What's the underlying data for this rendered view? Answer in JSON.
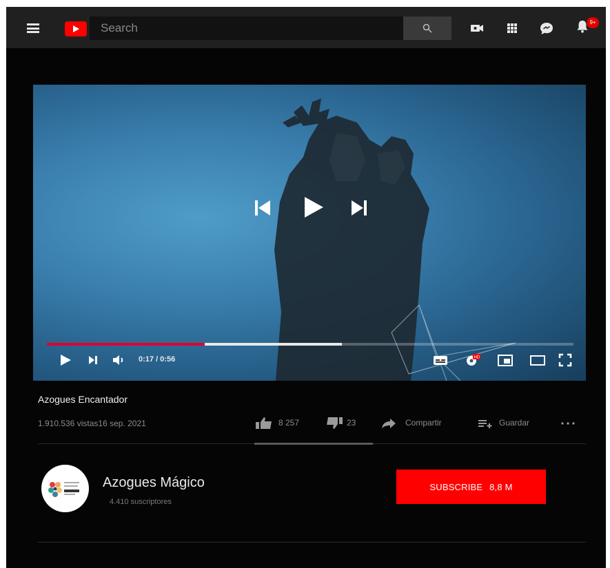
{
  "header": {
    "search_placeholder": "Search",
    "notification_count": "9+"
  },
  "player": {
    "current_time": "0:17",
    "duration": "0:56",
    "time_display": "0:17 / 0:56",
    "played_fraction": 0.3,
    "buffered_fraction": 0.56
  },
  "video": {
    "title": "Azogues Encantador",
    "views_date": "1.910.536 vistas16 sep. 2021",
    "likes": "8 257",
    "dislikes": "23",
    "share_label": "Compartir",
    "save_label": "Guardar"
  },
  "channel": {
    "name": "Azogues Mágico",
    "subscribers": "4.410 suscriptores",
    "subscribe_label": "SUBSCRIBE",
    "subscribe_count": "8,8 M"
  },
  "colors": {
    "accent": "#ff0000",
    "progress": "#e1002d",
    "background": "#050505",
    "topbar": "#202020"
  }
}
